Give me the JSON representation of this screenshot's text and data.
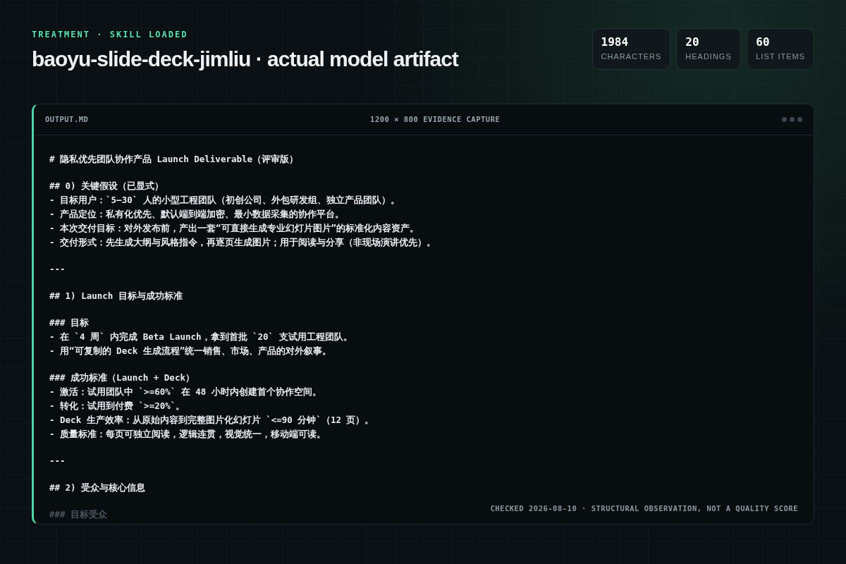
{
  "header": {
    "eyebrow": "TREATMENT · SKILL LOADED",
    "title": "baoyu-slide-deck-jimliu · actual model artifact"
  },
  "stats": [
    {
      "value": "1984",
      "label": "CHARACTERS"
    },
    {
      "value": "20",
      "label": "HEADINGS"
    },
    {
      "value": "60",
      "label": "LIST ITEMS"
    }
  ],
  "panel": {
    "filename": "OUTPUT.MD",
    "caption": "1200 × 800 EVIDENCE CAPTURE",
    "blocks": [
      {
        "faded": false,
        "lines": [
          "# 隐私优先团队协作产品 Launch Deliverable（评审版）"
        ]
      },
      {
        "faded": false,
        "lines": [
          "## 0) 关键假设（已显式）",
          "- 目标用户：`5–30` 人的小型工程团队（初创公司、外包研发组、独立产品团队）。",
          "- 产品定位：私有化优先、默认端到端加密、最小数据采集的协作平台。",
          "- 本次交付目标：对外发布前，产出一套“可直接生成专业幻灯片图片”的标准化内容资产。",
          "- 交付形式：先生成大纲与风格指令，再逐页生成图片；用于阅读与分享（非现场演讲优先）。"
        ]
      },
      {
        "faded": false,
        "lines": [
          "---"
        ]
      },
      {
        "faded": false,
        "lines": [
          "## 1) Launch 目标与成功标准"
        ]
      },
      {
        "faded": false,
        "lines": [
          "### 目标",
          "- 在 `4 周` 内完成 Beta Launch，拿到首批 `20` 支试用工程团队。",
          "- 用“可复制的 Deck 生成流程”统一销售、市场、产品的对外叙事。"
        ]
      },
      {
        "faded": false,
        "lines": [
          "### 成功标准（Launch + Deck）",
          "- 激活：试用团队中 `>=60%` 在 48 小时内创建首个协作空间。",
          "- 转化：试用到付费 `>=20%`。",
          "- Deck 生产效率：从原始内容到完整图片化幻灯片 `<=90 分钟`（12 页）。",
          "- 质量标准：每页可独立阅读，逻辑连贯，视觉统一，移动端可读。"
        ]
      },
      {
        "faded": false,
        "lines": [
          "---"
        ]
      },
      {
        "faded": false,
        "lines": [
          "## 2) 受众与核心信息"
        ]
      },
      {
        "faded": true,
        "lines": [
          "### 目标受众"
        ]
      }
    ],
    "footer": "CHECKED 2026-08-10 · STRUCTURAL OBSERVATION, NOT A QUALITY SCORE"
  }
}
